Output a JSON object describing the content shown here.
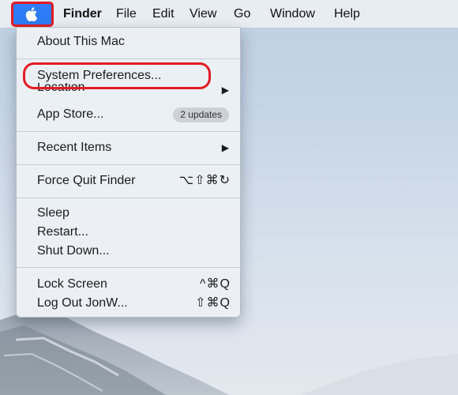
{
  "menubar": {
    "apple_icon": "apple-logo-icon",
    "items": [
      {
        "label": "Finder",
        "bold": true
      },
      {
        "label": "File"
      },
      {
        "label": "Edit"
      },
      {
        "label": "View"
      },
      {
        "label": "Go"
      },
      {
        "label": "Window"
      },
      {
        "label": "Help"
      }
    ]
  },
  "apple_menu": {
    "about": "About This Mac",
    "system_prefs": "System Preferences...",
    "location": "Location",
    "app_store": "App Store...",
    "app_store_badge": "2 updates",
    "recent_items": "Recent Items",
    "force_quit": "Force Quit Finder",
    "force_quit_shortcut": "⌥⇧⌘↻",
    "sleep": "Sleep",
    "restart": "Restart...",
    "shut_down": "Shut Down...",
    "lock_screen": "Lock Screen",
    "lock_screen_shortcut": "^⌘Q",
    "log_out": "Log Out JonW...",
    "log_out_shortcut": "⇧⌘Q",
    "submenu_arrow": "▶"
  },
  "colors": {
    "apple_button": "#2e7cf6",
    "annotation_red": "#e41b23"
  }
}
